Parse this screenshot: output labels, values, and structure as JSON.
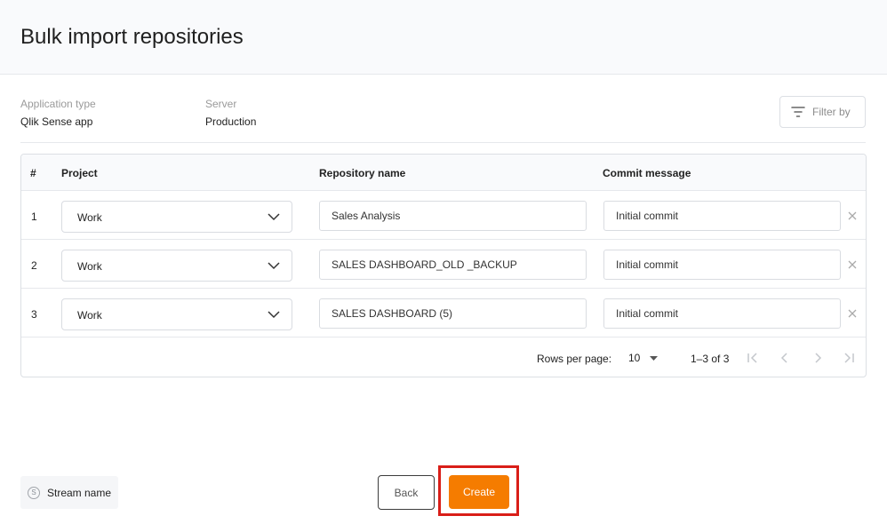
{
  "page": {
    "title": "Bulk import repositories"
  },
  "meta": {
    "application_type": {
      "label": "Application type",
      "value": "Qlik Sense app"
    },
    "server": {
      "label": "Server",
      "value": "Production"
    }
  },
  "filter": {
    "label": "Filter by",
    "icon": "filter-icon"
  },
  "table": {
    "headers": {
      "num": "#",
      "project": "Project",
      "repo": "Repository name",
      "commit": "Commit message"
    },
    "rows": [
      {
        "num": "1",
        "project": "Work",
        "repo": "Sales Analysis",
        "commit": "Initial commit"
      },
      {
        "num": "2",
        "project": "Work",
        "repo": "SALES DASHBOARD_OLD _BACKUP",
        "commit": "Initial commit"
      },
      {
        "num": "3",
        "project": "Work",
        "repo": "SALES DASHBOARD (5)",
        "commit": "Initial commit"
      }
    ]
  },
  "pagination": {
    "rows_per_page_label": "Rows per page:",
    "rows_per_page_value": "10",
    "range": "1–3 of 3"
  },
  "footer": {
    "stream_icon_letter": "S",
    "stream_label": "Stream name",
    "back_label": "Back",
    "create_label": "Create"
  },
  "colors": {
    "accent": "#f57c00",
    "highlight": "#d91e18"
  }
}
